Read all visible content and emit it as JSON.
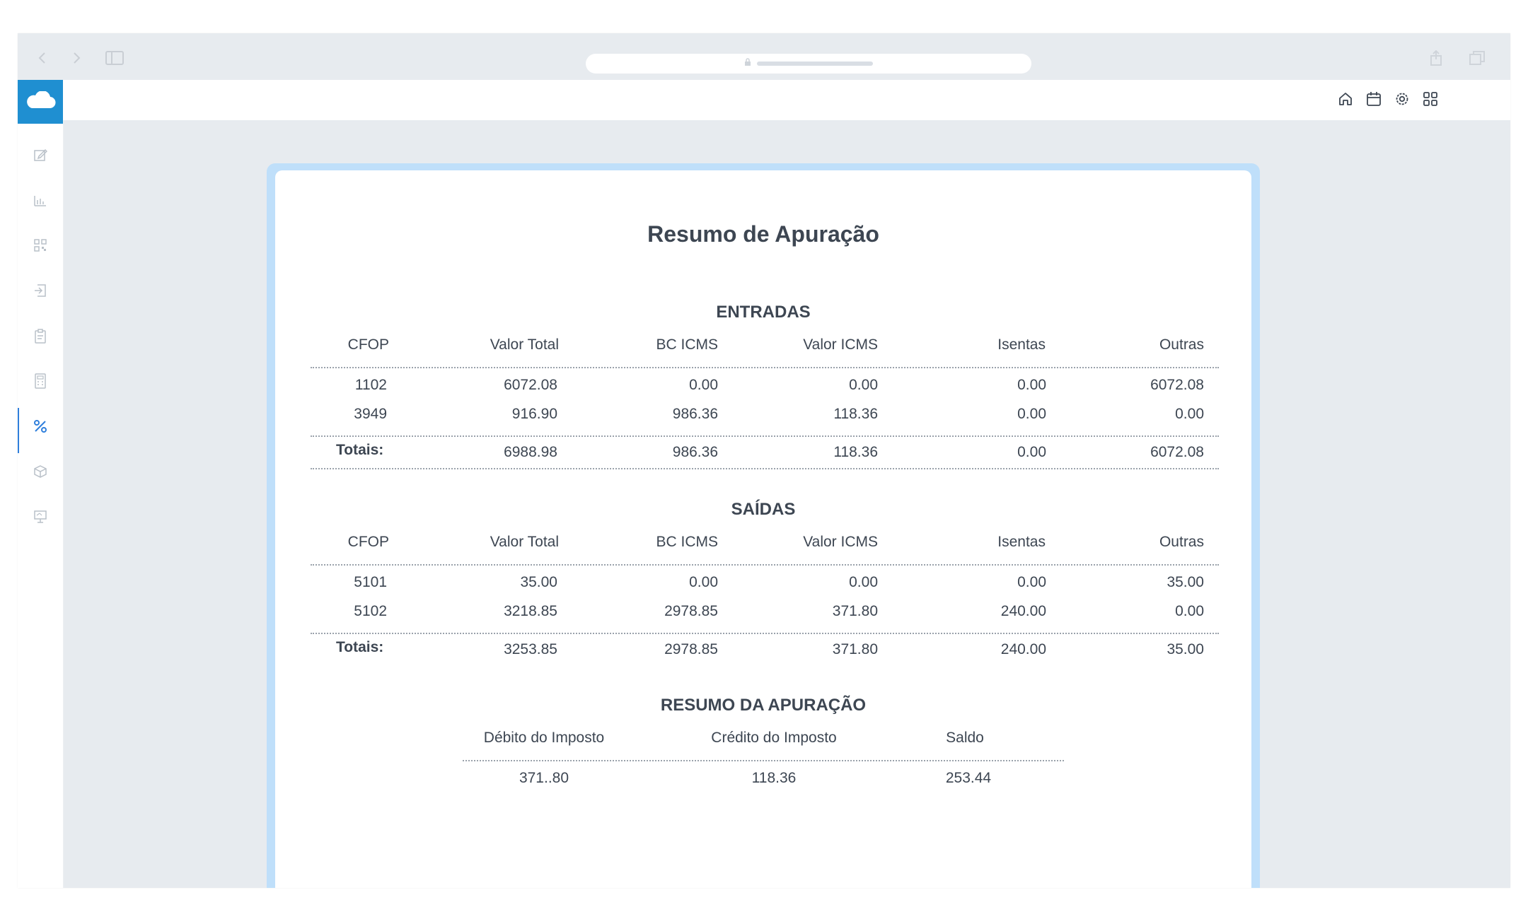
{
  "toolbar_icons": [
    "back-chevron-icon",
    "forward-chevron-icon",
    "sidebar-toggle-icon",
    "lock-icon",
    "share-icon",
    "tabs-icon"
  ],
  "sidebar": {
    "logo_icon": "cloud-icon",
    "items": [
      {
        "icon": "edit-icon"
      },
      {
        "icon": "bar-chart-icon"
      },
      {
        "icon": "qr-code-icon"
      },
      {
        "icon": "sign-in-icon"
      },
      {
        "icon": "clipboard-icon"
      },
      {
        "icon": "calculator-icon"
      },
      {
        "icon": "percent-icon",
        "active": true
      },
      {
        "icon": "cube-icon"
      },
      {
        "icon": "presentation-icon"
      }
    ]
  },
  "header_icons": [
    "home-icon",
    "calendar-icon",
    "settings-icon",
    "apps-grid-icon"
  ],
  "colors": {
    "accent": "#1f8fd1",
    "active": "#2f7fdc",
    "frame": "#bfdffa",
    "text": "#3d4652"
  },
  "report": {
    "title": "Resumo de Apuração",
    "headers": [
      "CFOP",
      "Valor Total",
      "BC ICMS",
      "Valor ICMS",
      "Isentas",
      "Outras"
    ],
    "totals_label": "Totais:",
    "entradas": {
      "title": "ENTRADAS",
      "rows": [
        [
          "1102",
          "6072.08",
          "0.00",
          "0.00",
          "0.00",
          "6072.08"
        ],
        [
          "3949",
          "916.90",
          "986.36",
          "118.36",
          "0.00",
          "0.00"
        ]
      ],
      "totals": [
        "6988.98",
        "986.36",
        "118.36",
        "0.00",
        "6072.08"
      ]
    },
    "saidas": {
      "title": "SAÍDAS",
      "rows": [
        [
          "5101",
          "35.00",
          "0.00",
          "0.00",
          "0.00",
          "35.00"
        ],
        [
          "5102",
          "3218.85",
          "2978.85",
          "371.80",
          "240.00",
          "0.00"
        ]
      ],
      "totals": [
        "3253.85",
        "2978.85",
        "371.80",
        "240.00",
        "35.00"
      ]
    },
    "resumo": {
      "title": "RESUMO DA APURAÇÃO",
      "headers": [
        "Débito do Imposto",
        "Crédito do Imposto",
        "Saldo"
      ],
      "values": [
        "371..80",
        "118.36",
        "253.44"
      ]
    }
  }
}
